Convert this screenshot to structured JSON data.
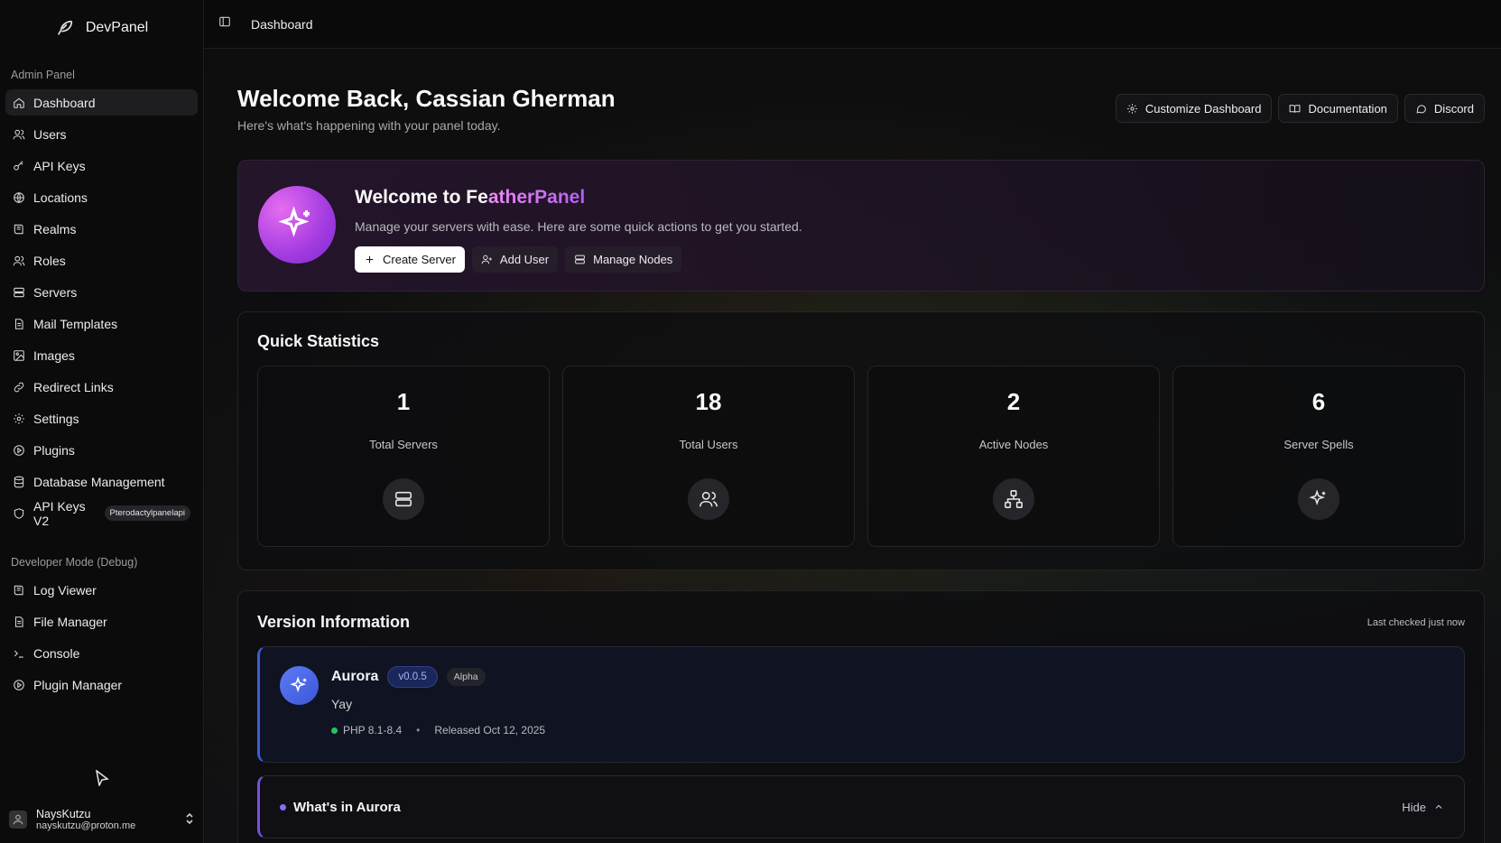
{
  "brand": {
    "name": "DevPanel"
  },
  "sidebar": {
    "admin_label": "Admin Panel",
    "admin_items": [
      {
        "label": "Dashboard",
        "icon": "home-icon"
      },
      {
        "label": "Users",
        "icon": "users-icon"
      },
      {
        "label": "API Keys",
        "icon": "key-icon"
      },
      {
        "label": "Locations",
        "icon": "globe-icon"
      },
      {
        "label": "Realms",
        "icon": "book-icon"
      },
      {
        "label": "Roles",
        "icon": "users-icon"
      },
      {
        "label": "Servers",
        "icon": "server-icon"
      },
      {
        "label": "Mail Templates",
        "icon": "file-icon"
      },
      {
        "label": "Images",
        "icon": "image-icon"
      },
      {
        "label": "Redirect Links",
        "icon": "link-icon"
      },
      {
        "label": "Settings",
        "icon": "gear-icon"
      },
      {
        "label": "Plugins",
        "icon": "play-circle-icon"
      },
      {
        "label": "Database Management",
        "icon": "database-icon"
      },
      {
        "label": "API Keys V2",
        "icon": "shield-icon",
        "tag": "Pterodactylpanelapi"
      }
    ],
    "dev_label": "Developer Mode (Debug)",
    "dev_items": [
      {
        "label": "Log Viewer",
        "icon": "book-icon"
      },
      {
        "label": "File Manager",
        "icon": "file-icon"
      },
      {
        "label": "Console",
        "icon": "terminal-icon"
      },
      {
        "label": "Plugin Manager",
        "icon": "play-circle-icon"
      }
    ],
    "user": {
      "name": "NaysKutzu",
      "email": "nayskutzu@proton.me"
    }
  },
  "topbar": {
    "breadcrumb": "Dashboard"
  },
  "header": {
    "title": "Welcome Back, Cassian Gherman",
    "subtitle": "Here's what's happening with your panel today.",
    "actions": [
      "Customize Dashboard",
      "Documentation",
      "Discord"
    ]
  },
  "welcome": {
    "title_prefix": "Welcome to Fe",
    "title_accent": "atherPanel",
    "subtitle": "Manage your servers with ease. Here are some quick actions to get you started.",
    "create_server": "Create Server",
    "add_user": "Add User",
    "manage_nodes": "Manage Nodes"
  },
  "stats": {
    "title": "Quick Statistics",
    "items": [
      {
        "value": "1",
        "label": "Total Servers",
        "icon": "server-icon"
      },
      {
        "value": "18",
        "label": "Total Users",
        "icon": "users-icon"
      },
      {
        "value": "2",
        "label": "Active Nodes",
        "icon": "network-icon"
      },
      {
        "value": "6",
        "label": "Server Spells",
        "icon": "sparkles-icon"
      }
    ]
  },
  "version": {
    "title": "Version Information",
    "last_checked": "Last checked just now",
    "name": "Aurora",
    "version": "v0.0.5",
    "channel": "Alpha",
    "description": "Yay",
    "php": "PHP 8.1-8.4",
    "separator": "•",
    "released": "Released Oct 12, 2025",
    "whats_in": "What's in Aurora",
    "hide": "Hide"
  },
  "colors": {
    "accent_purple": "#a33be0",
    "version_blue": "#3b5bd9",
    "status_green": "#22c55e"
  }
}
